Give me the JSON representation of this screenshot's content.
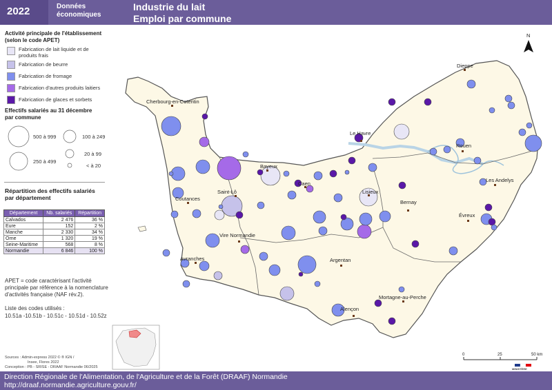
{
  "header": {
    "year": "2022",
    "subtitle": "Données économiques",
    "title_line1": "Industrie du lait",
    "title_line2": "Emploi par commune"
  },
  "legend_activity": {
    "title": "Activité principale de l'établissement (selon le code APET)",
    "items": [
      {
        "label_line1": "Fabrication de lait liquide et de",
        "label_line2": "produits frais",
        "color": "#e8e6f6"
      },
      {
        "label_line1": "Fabrication de beurre",
        "label_line2": "",
        "color": "#c6c2ea"
      },
      {
        "label_line1": "Fabrication de fromage",
        "label_line2": "",
        "color": "#7f8fee"
      },
      {
        "label_line1": "Fabrication d'autres produits laitiers",
        "label_line2": "",
        "color": "#a56ae8"
      },
      {
        "label_line1": "Fabrication de glaces et sorbets",
        "label_line2": "",
        "color": "#5a18a8"
      }
    ]
  },
  "legend_size": {
    "title": "Effectifs salariés au 31 décembre par commune",
    "classes": [
      "500 à 999",
      "100 à 249",
      "250 à 499",
      "20 à 99",
      "< à 20"
    ]
  },
  "repartition": {
    "title": "Répartition des effectifs salariés par département",
    "headers": [
      "Département",
      "Nb. salariés",
      "Répartition"
    ],
    "rows": [
      [
        "Calvados",
        "2 476",
        "36 %"
      ],
      [
        "Eure",
        "152",
        "2 %"
      ],
      [
        "Manche",
        "2 330",
        "34 %"
      ],
      [
        "Orne",
        "1 320",
        "19 %"
      ],
      [
        "Seine-Maritime",
        "568",
        "8 %"
      ],
      [
        "Normandie",
        "6 846",
        "100 %"
      ]
    ]
  },
  "notes": {
    "apet_line1": "APET = code caractérisant l'activité",
    "apet_line2": "principale par référence à la nomenclature",
    "apet_line3": "d'activités française (NAF rév.2).",
    "codes_title": "Liste des codes utilisés :",
    "codes": "10.51a -10.51b - 10.51c - 10.51d - 10.52z"
  },
  "sources": {
    "line1": "Sources : Admin-express 2022 © ® IGN /",
    "line2": "Insee, Flores 2022",
    "line3": "Conception : PB - SRISE - DRAAF Normandie 06/2025"
  },
  "footer": {
    "line1": "Direction Régionale de l'Alimentation, de l'Agriculture et de la Forêt (DRAAF) Normandie",
    "line2": "http://draaf.normandie.agriculture.gouv.fr/"
  },
  "map": {
    "north": "N",
    "scale_labels": [
      "0",
      "25",
      "50 km"
    ],
    "cities": [
      "Dieppe",
      "Cherbourg-en-Cotentin",
      "Le Havre",
      "Rouen",
      "Bayeux",
      "Caen",
      "Lisieux",
      "Les Andelys",
      "Saint-Lô",
      "Coutances",
      "Bernay",
      "Évreux",
      "Vire Normandie",
      "Avranches",
      "Argentan",
      "Mortagne-au-Perche",
      "Alençon"
    ]
  },
  "ministry": {
    "line1": "MINISTÈRE",
    "line2": "DE L'AGRICULTURE",
    "line3": "ET DE LA SOUVERAINETÉ",
    "line4": "ALIMENTAIRE"
  }
}
